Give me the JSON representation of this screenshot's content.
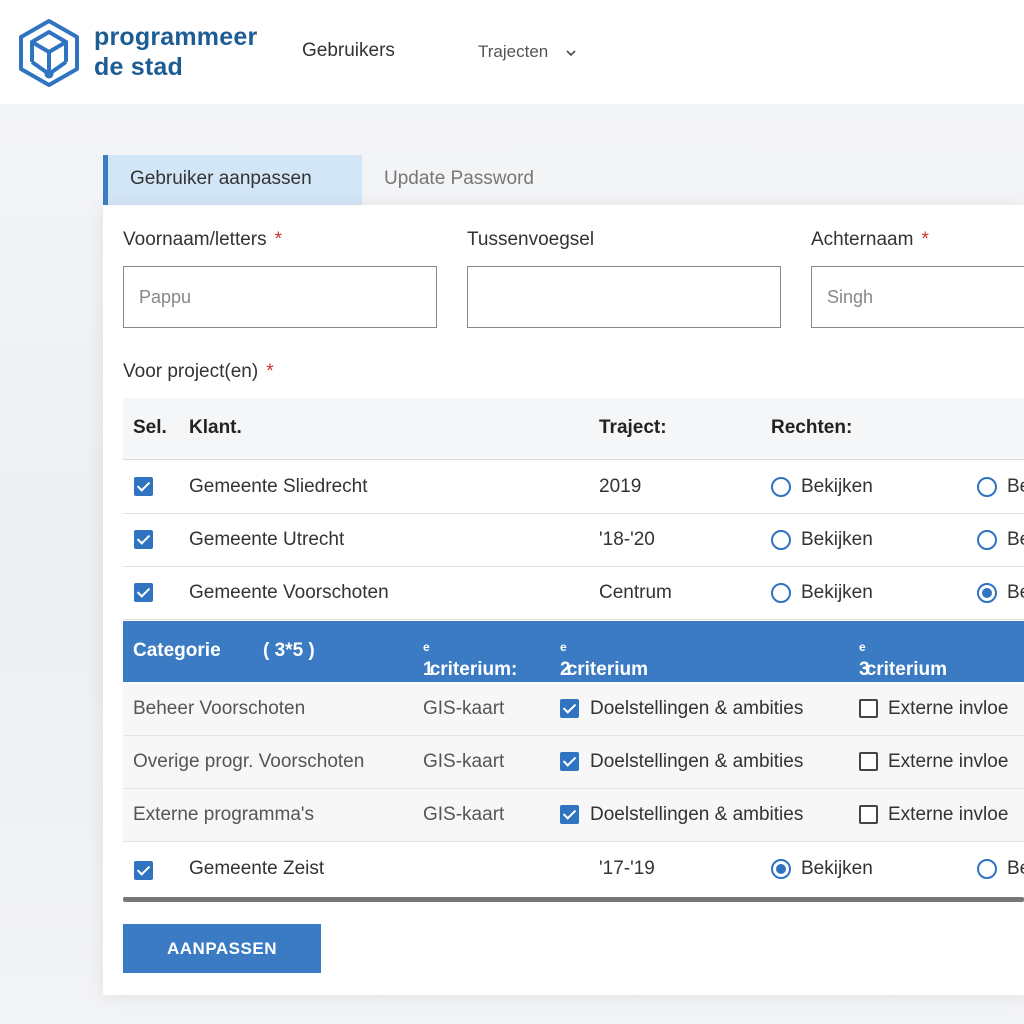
{
  "header": {
    "logo_line1": "programmeer",
    "logo_line2": "de stad",
    "nav_users": "Gebruikers",
    "nav_trajects": "Trajecten"
  },
  "tabs": {
    "active": "Gebruiker aanpassen",
    "inactive": "Update Password"
  },
  "form": {
    "first_name_label": "Voornaam/letters",
    "first_name_placeholder": "Pappu",
    "infix_label": "Tussenvoegsel",
    "infix_placeholder": "",
    "last_name_label": "Achternaam",
    "last_name_placeholder": "Singh",
    "required_mark": "*",
    "projects_label": "Voor project(en)"
  },
  "projects": {
    "headers": {
      "sel": "Sel.",
      "client": "Klant.",
      "traject": "Traject:",
      "rights": "Rechten:"
    },
    "rows": [
      {
        "client": "Gemeente Sliedrecht",
        "traject": "2019",
        "right1": "Bekijken",
        "right2": "Be"
      },
      {
        "client": "Gemeente Utrecht",
        "traject": "'18-'20",
        "right1": "Bekijken",
        "right2": "Be"
      },
      {
        "client": "Gemeente Voorschoten",
        "traject": "Centrum",
        "right1": "Bekijken",
        "right2": "Be"
      },
      {
        "client": "Gemeente Zeist",
        "traject": "'17-'19",
        "right1": "Bekijken",
        "right2": "Be"
      }
    ]
  },
  "categories": {
    "headers": {
      "category": "Categorie",
      "count": "( 3*5 )",
      "c1_num": "1",
      "c1_label": "criterium:",
      "c2_num": "2",
      "c2_label": "criterium",
      "c3_num": "3",
      "c3_label": "criterium",
      "ordinal_suffix": "e"
    },
    "rows": [
      {
        "name": "Beheer Voorschoten",
        "c1": "GIS-kaart",
        "c2": "Doelstellingen & ambities",
        "c3": "Externe invloe"
      },
      {
        "name": "Overige progr. Voorschoten",
        "c1": "GIS-kaart",
        "c2": "Doelstellingen & ambities",
        "c3": "Externe invloe"
      },
      {
        "name": "Externe programma's",
        "c1": "GIS-kaart",
        "c2": "Doelstellingen & ambities",
        "c3": "Externe invloe"
      }
    ]
  },
  "actions": {
    "submit": "AANPASSEN"
  },
  "colors": {
    "accent": "#3b7bc3",
    "brand": "#1d5d94",
    "required": "#d0312d"
  }
}
